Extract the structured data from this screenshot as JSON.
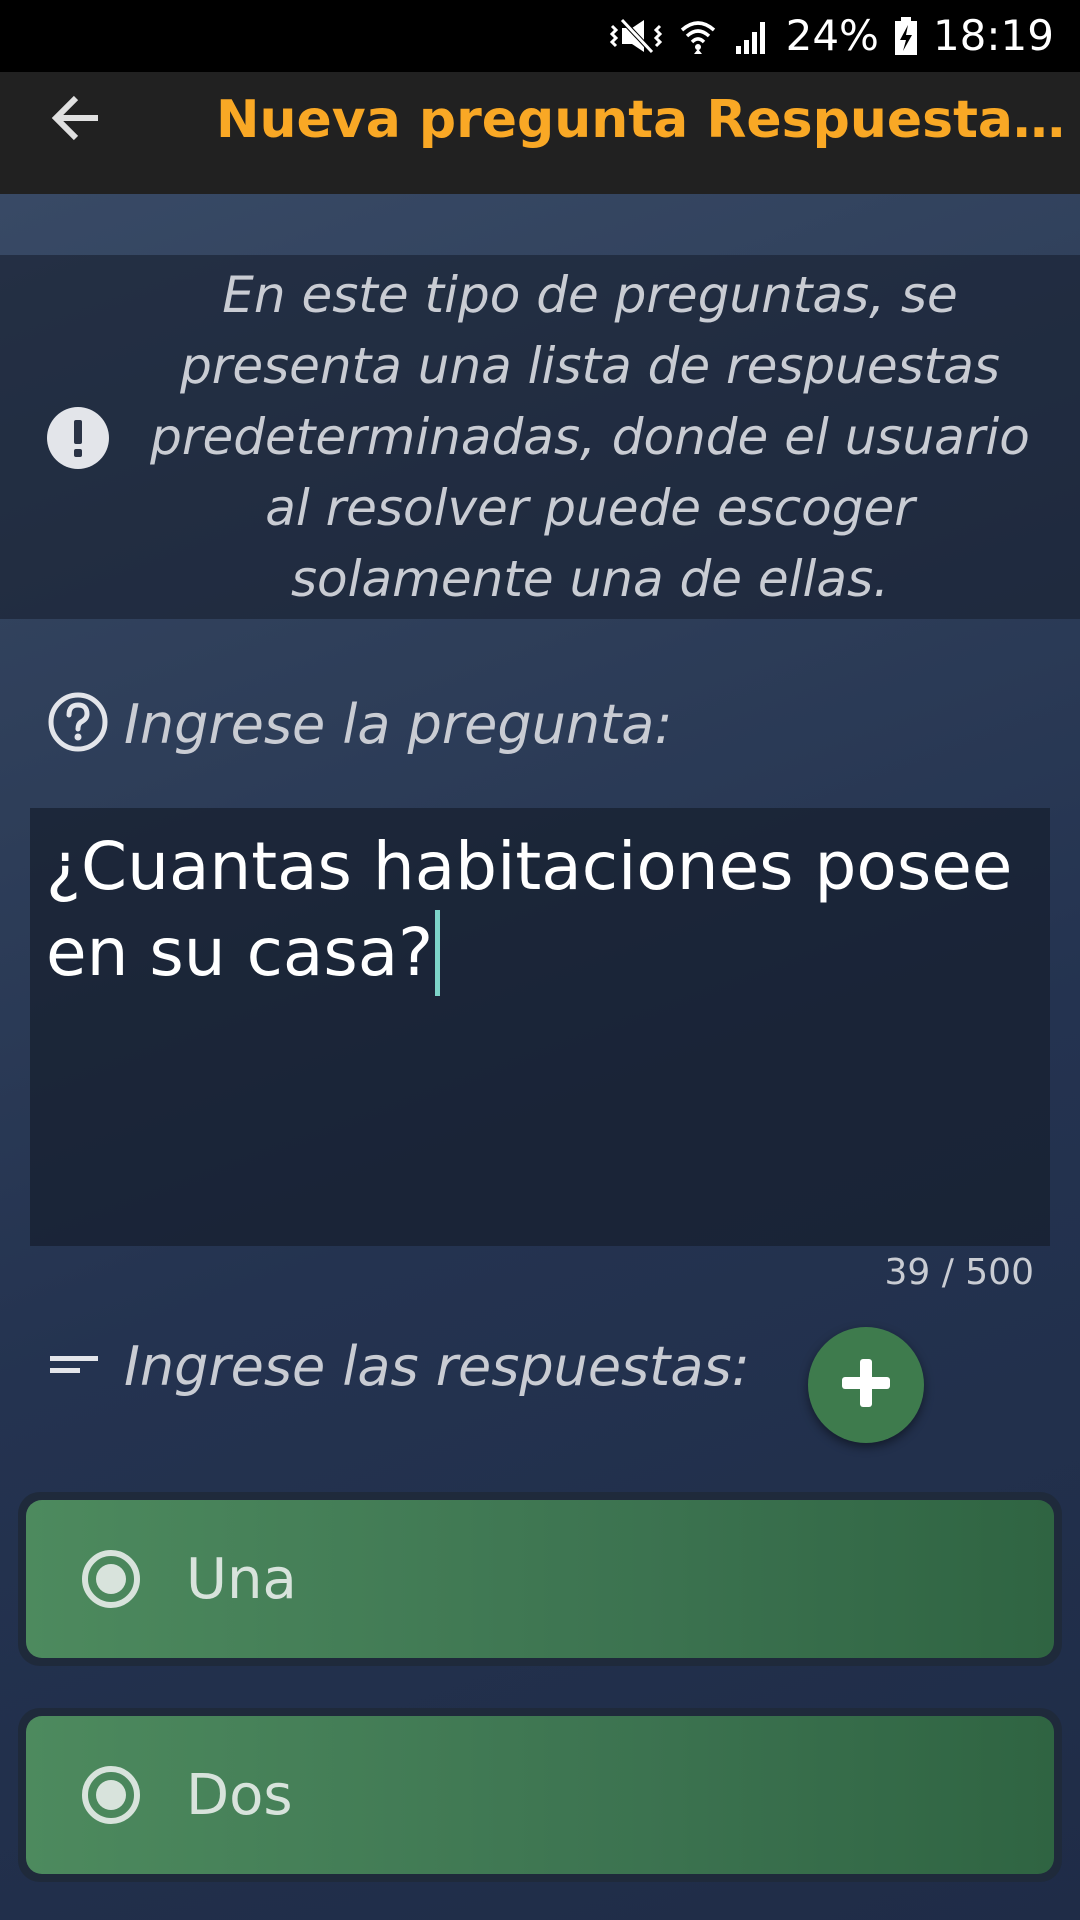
{
  "status_bar": {
    "battery": "24%",
    "time": "18:19",
    "icons": [
      "vibrate-mute-icon",
      "wifi-icon",
      "signal-icon",
      "battery-charging-icon"
    ]
  },
  "app_bar": {
    "back_icon": "arrow-left-icon",
    "title": "Nueva pregunta Respuesta Única",
    "title_color": "#f9a825"
  },
  "info": {
    "icon": "exclamation-icon",
    "text": "En este tipo de preguntas, se presenta una lista de respuestas predeterminadas, donde el usuario al resolver puede escoger solamente una de ellas."
  },
  "question": {
    "icon": "help-circle-icon",
    "label": "Ingrese la pregunta:",
    "value": "¿Cuantas habitaciones posee en su casa?",
    "counter": "39 / 500"
  },
  "answers": {
    "icon": "short-text-icon",
    "label": "Ingrese las respuestas:",
    "add_icon": "plus-icon",
    "accent": "#3e7b4d",
    "items": [
      {
        "label": "Una",
        "icon": "radio-checked-icon"
      },
      {
        "label": "Dos",
        "icon": "radio-checked-icon"
      }
    ]
  }
}
